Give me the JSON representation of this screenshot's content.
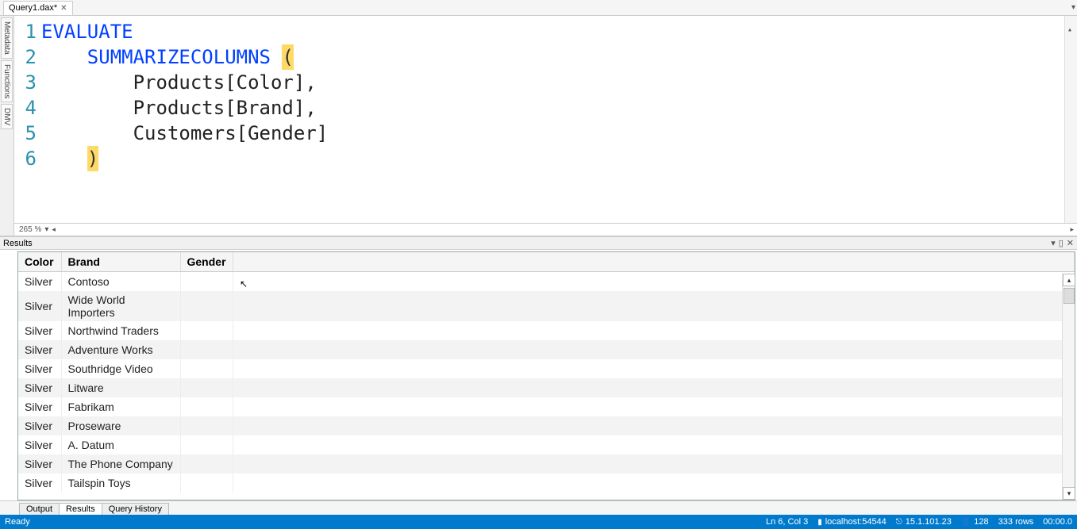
{
  "tab": {
    "title": "Query1.dax*",
    "close": "✕"
  },
  "side_tabs": [
    "Metadata",
    "Functions",
    "DMV"
  ],
  "code": {
    "lines": [
      1,
      2,
      3,
      4,
      5,
      6
    ],
    "l1_kw": "EVALUATE",
    "l2_indent": "    ",
    "l2_kw": "SUMMARIZECOLUMNS",
    "l2_sp": " ",
    "l2_p": "(",
    "l3": "        Products[Color],",
    "l4": "        Products[Brand],",
    "l5": "        Customers[Gender]",
    "l6_indent": "    ",
    "l6_p": ")"
  },
  "zoom": "265 %",
  "results": {
    "title": "Results",
    "cols": [
      "Color",
      "Brand",
      "Gender"
    ],
    "rows": [
      {
        "c": "Silver",
        "b": "Contoso",
        "g": ""
      },
      {
        "c": "Silver",
        "b": "Wide World Importers",
        "g": ""
      },
      {
        "c": "Silver",
        "b": "Northwind Traders",
        "g": ""
      },
      {
        "c": "Silver",
        "b": "Adventure Works",
        "g": ""
      },
      {
        "c": "Silver",
        "b": "Southridge Video",
        "g": ""
      },
      {
        "c": "Silver",
        "b": "Litware",
        "g": ""
      },
      {
        "c": "Silver",
        "b": "Fabrikam",
        "g": ""
      },
      {
        "c": "Silver",
        "b": "Proseware",
        "g": ""
      },
      {
        "c": "Silver",
        "b": "A. Datum",
        "g": ""
      },
      {
        "c": "Silver",
        "b": "The Phone Company",
        "g": ""
      },
      {
        "c": "Silver",
        "b": "Tailspin Toys",
        "g": ""
      }
    ]
  },
  "bottom_tabs": {
    "output": "Output",
    "results": "Results",
    "history": "Query History"
  },
  "status": {
    "ready": "Ready",
    "pos": "Ln 6, Col 3",
    "server": "localhost:54544",
    "version": "15.1.101.23",
    "conns": "128",
    "rows": "333 rows",
    "time": "00:00.0"
  }
}
